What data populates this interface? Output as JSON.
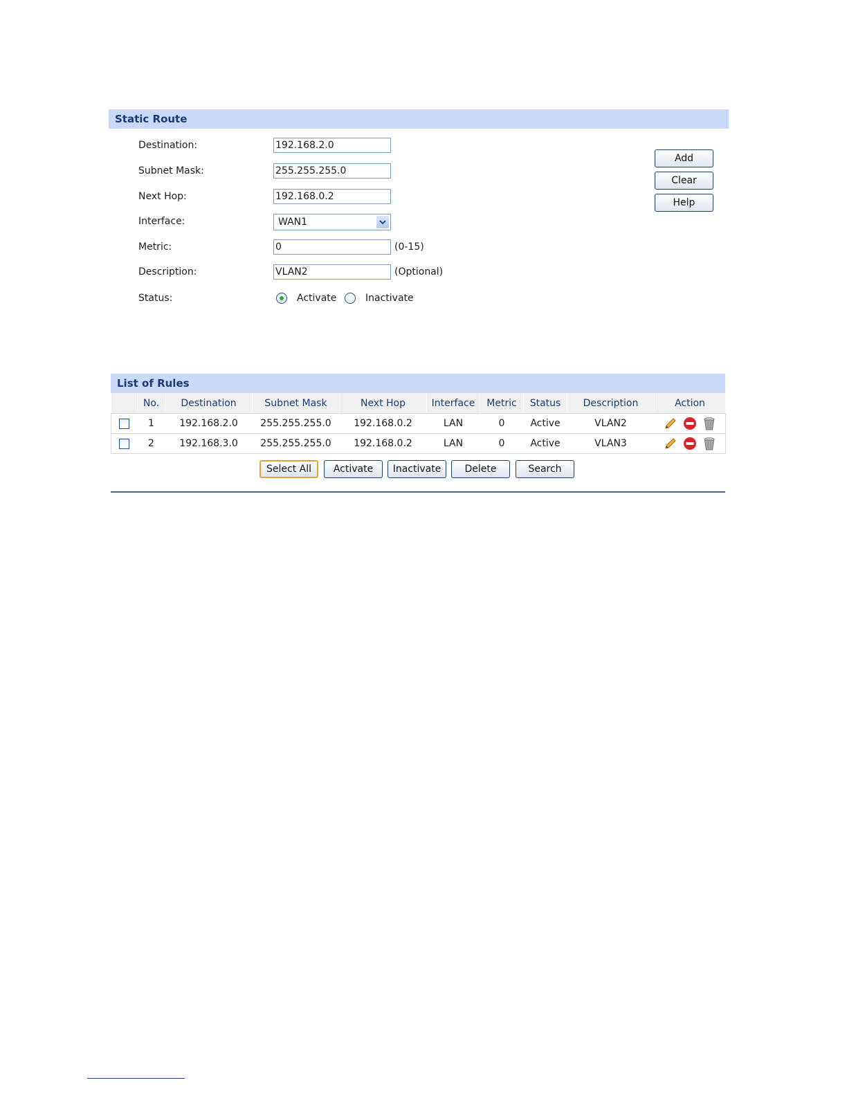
{
  "static_route": {
    "title": "Static Route",
    "fields": {
      "destination": {
        "label": "Destination:",
        "value": "192.168.2.0"
      },
      "subnet_mask": {
        "label": "Subnet Mask:",
        "value": "255.255.255.0"
      },
      "next_hop": {
        "label": "Next Hop:",
        "value": "192.168.0.2"
      },
      "interface": {
        "label": "Interface:",
        "value": "WAN1"
      },
      "metric": {
        "label": "Metric:",
        "value": "0",
        "hint": "(0-15)"
      },
      "description": {
        "label": "Description:",
        "value": "VLAN2",
        "hint": "(Optional)"
      },
      "status": {
        "label": "Status:",
        "options": [
          "Activate",
          "Inactivate"
        ],
        "selected": "Activate"
      }
    },
    "buttons": {
      "add": "Add",
      "clear": "Clear",
      "help": "Help"
    }
  },
  "rules": {
    "title": "List of Rules",
    "columns": [
      "",
      "No.",
      "Destination",
      "Subnet Mask",
      "Next Hop",
      "Interface",
      "Metric",
      "Status",
      "Description",
      "Action"
    ],
    "rows": [
      {
        "no": "1",
        "destination": "192.168.2.0",
        "subnet_mask": "255.255.255.0",
        "next_hop": "192.168.0.2",
        "interface": "LAN",
        "metric": "0",
        "status": "Active",
        "description": "VLAN2"
      },
      {
        "no": "2",
        "destination": "192.168.3.0",
        "subnet_mask": "255.255.255.0",
        "next_hop": "192.168.0.2",
        "interface": "LAN",
        "metric": "0",
        "status": "Active",
        "description": "VLAN3"
      }
    ],
    "action_icons": [
      "edit-icon",
      "disable-icon",
      "delete-icon"
    ],
    "buttons": {
      "select_all": "Select All",
      "activate": "Activate",
      "inactivate": "Inactivate",
      "delete": "Delete",
      "search": "Search"
    }
  },
  "colors": {
    "header_bg": "#c9daf8",
    "header_text": "#1b3a73",
    "divider": "#3d6d94",
    "radio_dot": "#36a83c"
  }
}
